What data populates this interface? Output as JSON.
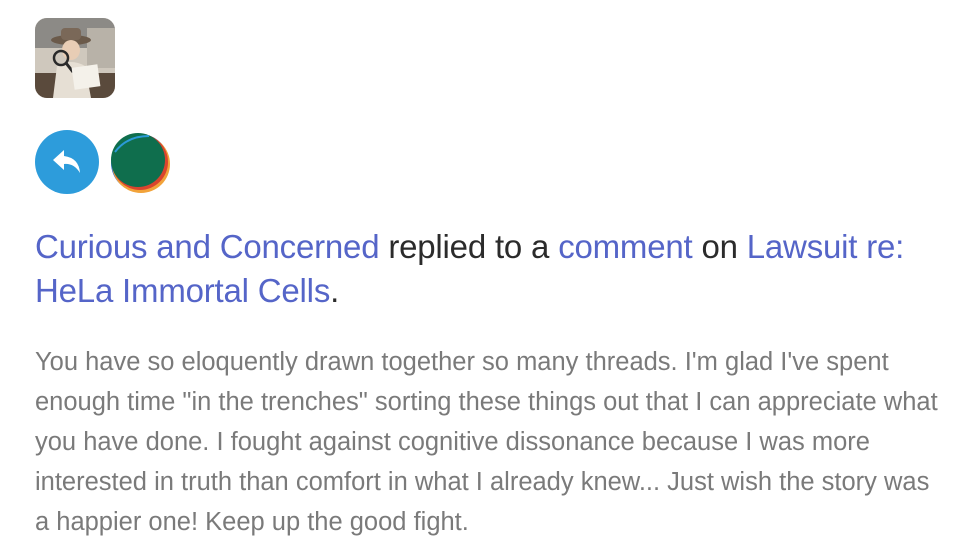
{
  "colors": {
    "link": "#5565c8",
    "text_dark": "#2b2b2b",
    "text_muted": "#7a7a7a",
    "reply_badge": "#2d9cdb"
  },
  "icons": {
    "avatar": "user-avatar-photo",
    "action": "reply-arrow-icon",
    "publication": "publication-logo-icon"
  },
  "notification": {
    "actor": "Curious and Concerned",
    "verb": "replied to a",
    "object": "comment",
    "preposition": "on",
    "post_title": "Lawsuit re: HeLa Immortal Cells",
    "period": "."
  },
  "comment": {
    "text": "You have so eloquently drawn together so many threads. I'm glad I've spent enough time \"in the trenches\" sorting these things out that I can appreciate what you have done. I fought against cognitive dissonance because I was more interested in truth than comfort in what I already knew... Just wish the story was a happier one! Keep up the good fight."
  }
}
